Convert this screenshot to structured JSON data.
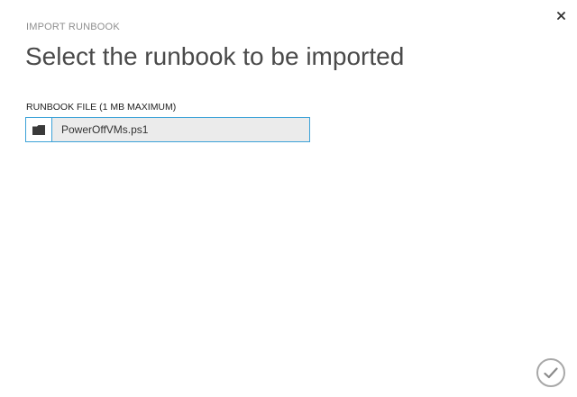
{
  "dialog": {
    "eyebrow": "IMPORT RUNBOOK",
    "title": "Select the runbook to be imported",
    "close_icon": "close-icon",
    "confirm_icon": "checkmark-icon"
  },
  "file_field": {
    "label": "RUNBOOK FILE (1 MB MAXIMUM)",
    "value": "PowerOffVMs.ps1",
    "browse_icon": "folder-icon"
  },
  "colors": {
    "accent": "#3ca2d8",
    "title": "#4a4a4a",
    "muted": "#8f8f8f",
    "field_bg": "#ebebeb",
    "confirm_border": "#a8a8a8"
  }
}
